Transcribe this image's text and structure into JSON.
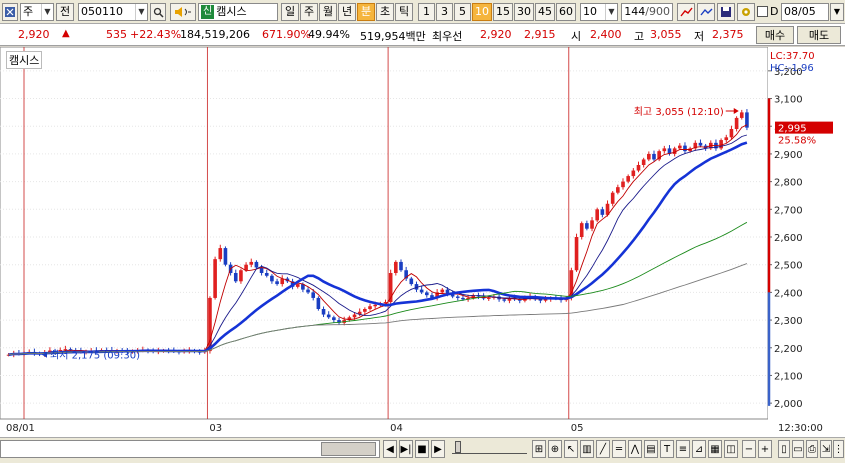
{
  "toolbar": {
    "market": "주",
    "market_mode": "전",
    "code": "050110",
    "stock_tag": "신",
    "stock_name": "캠시스",
    "periods": [
      "일",
      "주",
      "월",
      "년",
      "분",
      "초",
      "틱"
    ],
    "active_period": "분",
    "intervals": [
      "1",
      "3",
      "5",
      "10",
      "15",
      "30",
      "45",
      "60"
    ],
    "active_interval": "10",
    "count": "10",
    "range": "144",
    "range_total": "/900",
    "checkbox_label": "D",
    "date": "08/05"
  },
  "quote": {
    "price": "2,920",
    "change": "535",
    "change_pct": "+22.43%",
    "volume": "184,519,206",
    "volume_ratio": "671.90%",
    "turnover": "49.94%",
    "amount": "519,954백만",
    "best_label": "최우선",
    "best_bid": "2,920",
    "best_ask": "2,915",
    "open_label": "시",
    "open": "2,400",
    "high_label": "고",
    "high": "3,055",
    "low_label": "저",
    "low": "2,375",
    "buy_label": "매수",
    "sell_label": "매도"
  },
  "chart_meta": {
    "title": "캠시스",
    "lc": "LC:37.70",
    "hc": "HC:-1.96",
    "high_annotation": "최고 3,055 (12:10)",
    "low_annotation": "최저 2,175 (09:30)",
    "current_price_label": "2,995",
    "current_pct_label": "25.58%",
    "time_label": "12:30:00",
    "colors": {
      "up": "#e02020",
      "down": "#1a3ec2",
      "ma5": "#c00000",
      "ma10": "#1a1a8a",
      "ma20": "#1533d6",
      "ma60": "#1a8a1a",
      "ma120": "#7a7a7a"
    }
  },
  "chart_data": {
    "type": "line",
    "title": "캠시스",
    "xlabel": "",
    "ylabel": "",
    "x_tick_labels": [
      "08/01",
      "03",
      "04",
      "05"
    ],
    "y_tick_labels": [
      "2,000",
      "2,100",
      "2,200",
      "2,300",
      "2,400",
      "2,500",
      "2,600",
      "2,700",
      "2,800",
      "2,900",
      "3,000",
      "3,100",
      "3,200"
    ],
    "ylim": [
      1950,
      3250
    ],
    "grid": true,
    "candle_count": 144,
    "session_start_candles": [
      0,
      39,
      74,
      109
    ],
    "series": [
      {
        "name": "price_close",
        "role": "candles",
        "values": [
          2175,
          2180,
          2178,
          2182,
          2185,
          2180,
          2176,
          2183,
          2190,
          2188,
          2192,
          2195,
          2190,
          2188,
          2185,
          2187,
          2190,
          2189,
          2192,
          2191,
          2188,
          2190,
          2187,
          2185,
          2188,
          2190,
          2192,
          2189,
          2186,
          2188,
          2190,
          2189,
          2187,
          2185,
          2188,
          2190,
          2186,
          2184,
          2188,
          2380,
          2520,
          2560,
          2500,
          2470,
          2440,
          2480,
          2500,
          2510,
          2490,
          2470,
          2460,
          2440,
          2430,
          2450,
          2440,
          2420,
          2430,
          2410,
          2400,
          2380,
          2340,
          2320,
          2310,
          2300,
          2290,
          2300,
          2310,
          2320,
          2330,
          2340,
          2350,
          2355,
          2360,
          2365,
          2470,
          2510,
          2480,
          2450,
          2430,
          2410,
          2400,
          2390,
          2380,
          2400,
          2410,
          2395,
          2385,
          2380,
          2375,
          2380,
          2390,
          2385,
          2378,
          2380,
          2385,
          2375,
          2370,
          2380,
          2375,
          2370,
          2380,
          2385,
          2375,
          2370,
          2375,
          2380,
          2378,
          2372,
          2380,
          2480,
          2600,
          2650,
          2630,
          2660,
          2700,
          2680,
          2720,
          2760,
          2780,
          2800,
          2820,
          2840,
          2860,
          2880,
          2900,
          2880,
          2910,
          2920,
          2900,
          2920,
          2930,
          2910,
          2920,
          2940,
          2930,
          2920,
          2940,
          2920,
          2950,
          2960,
          2990,
          3030,
          3050,
          2995
        ]
      }
    ]
  }
}
